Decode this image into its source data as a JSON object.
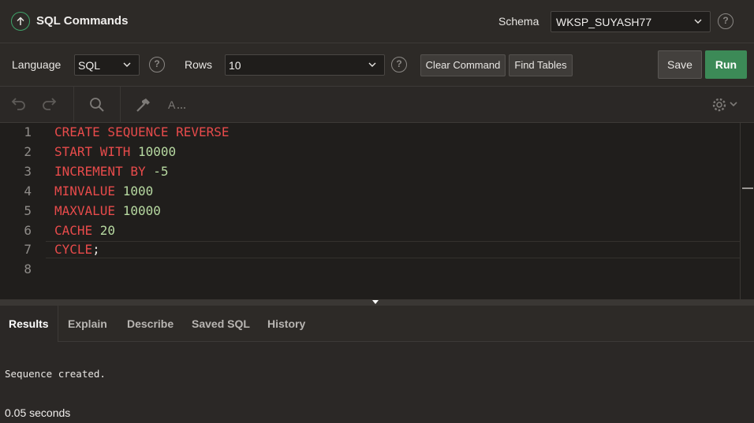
{
  "header": {
    "title": "SQL Commands",
    "schema_label": "Schema",
    "schema_value": "WKSP_SUYASH77"
  },
  "options": {
    "language_label": "Language",
    "language_value": "SQL",
    "rows_label": "Rows",
    "rows_value": "10",
    "clear_label": "Clear Command",
    "find_label": "Find Tables",
    "save_label": "Save",
    "run_label": "Run"
  },
  "editor": {
    "line_numbers": [
      "1",
      "2",
      "3",
      "4",
      "5",
      "6",
      "7",
      "8"
    ],
    "lines": [
      [
        {
          "t": "CREATE SEQUENCE REVERSE",
          "c": "kw"
        }
      ],
      [
        {
          "t": "START WITH ",
          "c": "kw"
        },
        {
          "t": "10000",
          "c": "num"
        }
      ],
      [
        {
          "t": "INCREMENT BY ",
          "c": "kw"
        },
        {
          "t": "-5",
          "c": "num"
        }
      ],
      [
        {
          "t": "MINVALUE ",
          "c": "kw"
        },
        {
          "t": "1000",
          "c": "num"
        }
      ],
      [
        {
          "t": "MAXVALUE ",
          "c": "kw"
        },
        {
          "t": "10000",
          "c": "num"
        }
      ],
      [
        {
          "t": "CACHE ",
          "c": "kw"
        },
        {
          "t": "20",
          "c": "num"
        }
      ],
      [
        {
          "t": "CYCLE",
          "c": "kw"
        },
        {
          "t": ";",
          "c": "plain"
        }
      ],
      []
    ]
  },
  "tabs": [
    {
      "label": "Results",
      "active": true
    },
    {
      "label": "Explain",
      "active": false
    },
    {
      "label": "Describe",
      "active": false
    },
    {
      "label": "Saved SQL",
      "active": false
    },
    {
      "label": "History",
      "active": false
    }
  ],
  "results": {
    "message": "Sequence created.",
    "time": "0.05 seconds"
  },
  "colors": {
    "accent": "#3c8a57",
    "keyword": "#e84b4b",
    "number": "#b7d9a1"
  }
}
